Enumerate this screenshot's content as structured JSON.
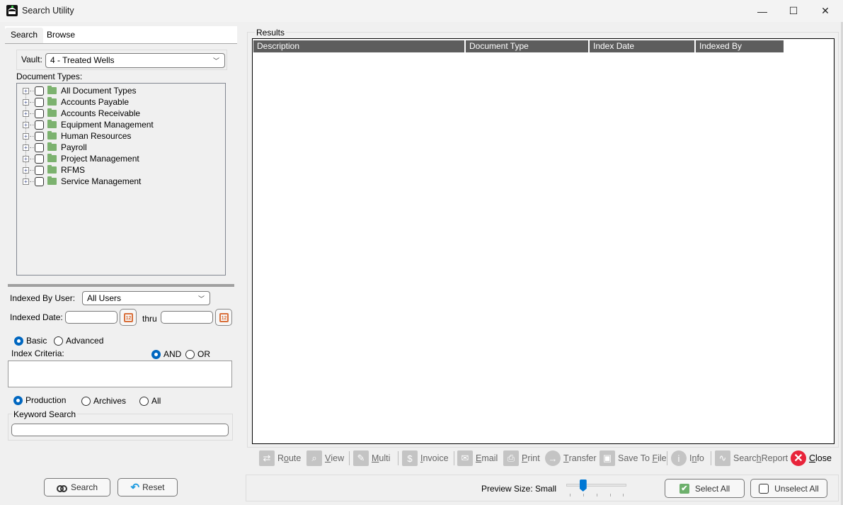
{
  "window": {
    "title": "Search Utility",
    "controls": {
      "minimize": "—",
      "maximize": "☐",
      "close": "✕"
    }
  },
  "tabs": [
    {
      "label": "Search",
      "active": true
    },
    {
      "label": "Browse",
      "active": false
    }
  ],
  "search_panel": {
    "vault_label": "Vault:",
    "vault_value": "4 - Treated Wells",
    "document_types_label": "Document Types:",
    "document_types": [
      {
        "label": "All Document Types",
        "checked": false
      },
      {
        "label": "Accounts Payable",
        "checked": false
      },
      {
        "label": "Accounts Receivable",
        "checked": false
      },
      {
        "label": "Equipment Management",
        "checked": false
      },
      {
        "label": "Human Resources",
        "checked": false
      },
      {
        "label": "Payroll",
        "checked": false
      },
      {
        "label": "Project Management",
        "checked": false
      },
      {
        "label": "RFMS",
        "checked": false
      },
      {
        "label": "Service Management",
        "checked": false
      }
    ],
    "indexed_by_user_label": "Indexed By User:",
    "indexed_by_user_value": "All Users",
    "indexed_date_label": "Indexed Date:",
    "date_from": "",
    "thru_label": "thru",
    "date_to": "",
    "calendar_icon_text": "12",
    "mode_options": [
      {
        "label": "Basic",
        "selected": true
      },
      {
        "label": "Advanced",
        "selected": false
      }
    ],
    "index_criteria_label": "Index Criteria:",
    "logic_options": [
      {
        "label": "AND",
        "selected": true
      },
      {
        "label": "OR",
        "selected": false
      }
    ],
    "index_criteria_value": "",
    "source_options": [
      {
        "label": "Production",
        "selected": true
      },
      {
        "label": "Archives",
        "selected": false
      },
      {
        "label": "All",
        "selected": false
      }
    ],
    "keyword_search_label": "Keyword Search",
    "keyword_search_value": "",
    "search_button": "Search",
    "reset_button": "Reset"
  },
  "results": {
    "group_label": "Results",
    "columns": [
      "Description",
      "Document Type",
      "Index Date",
      "Indexed By"
    ],
    "rows": []
  },
  "toolbar": {
    "route": {
      "pre": "R",
      "key": "o",
      "post": "ute"
    },
    "view": {
      "pre": "",
      "key": "V",
      "post": "iew"
    },
    "multi": {
      "pre": "",
      "key": "M",
      "post": "ulti"
    },
    "invoice": {
      "pre": "",
      "key": "I",
      "post": "nvoice"
    },
    "email": {
      "pre": "",
      "key": "E",
      "post": "mail"
    },
    "print": {
      "pre": "",
      "key": "P",
      "post": "rint"
    },
    "transfer": {
      "pre": "",
      "key": "T",
      "post": "ransfer"
    },
    "save_to_file": {
      "pre": "Save To ",
      "key": "F",
      "post": "ile"
    },
    "info": {
      "pre": "I",
      "key": "n",
      "post": "fo"
    },
    "search_report": {
      "pre": "Searc",
      "key": "h",
      "post": " Report"
    },
    "close": {
      "pre": "",
      "key": "C",
      "post": "lose"
    }
  },
  "bottom_bar": {
    "preview_size_label": "Preview Size: Small",
    "preview_slider": {
      "position": 1,
      "max": 4
    },
    "select_all": "Select All",
    "unselect_all": "Unselect All"
  },
  "colors": {
    "accent": "#0067c0",
    "folder": "#7cb26f",
    "header_bg": "#5d5d5d",
    "close_red": "#e8243a",
    "calendar_orange": "#d9703b"
  }
}
